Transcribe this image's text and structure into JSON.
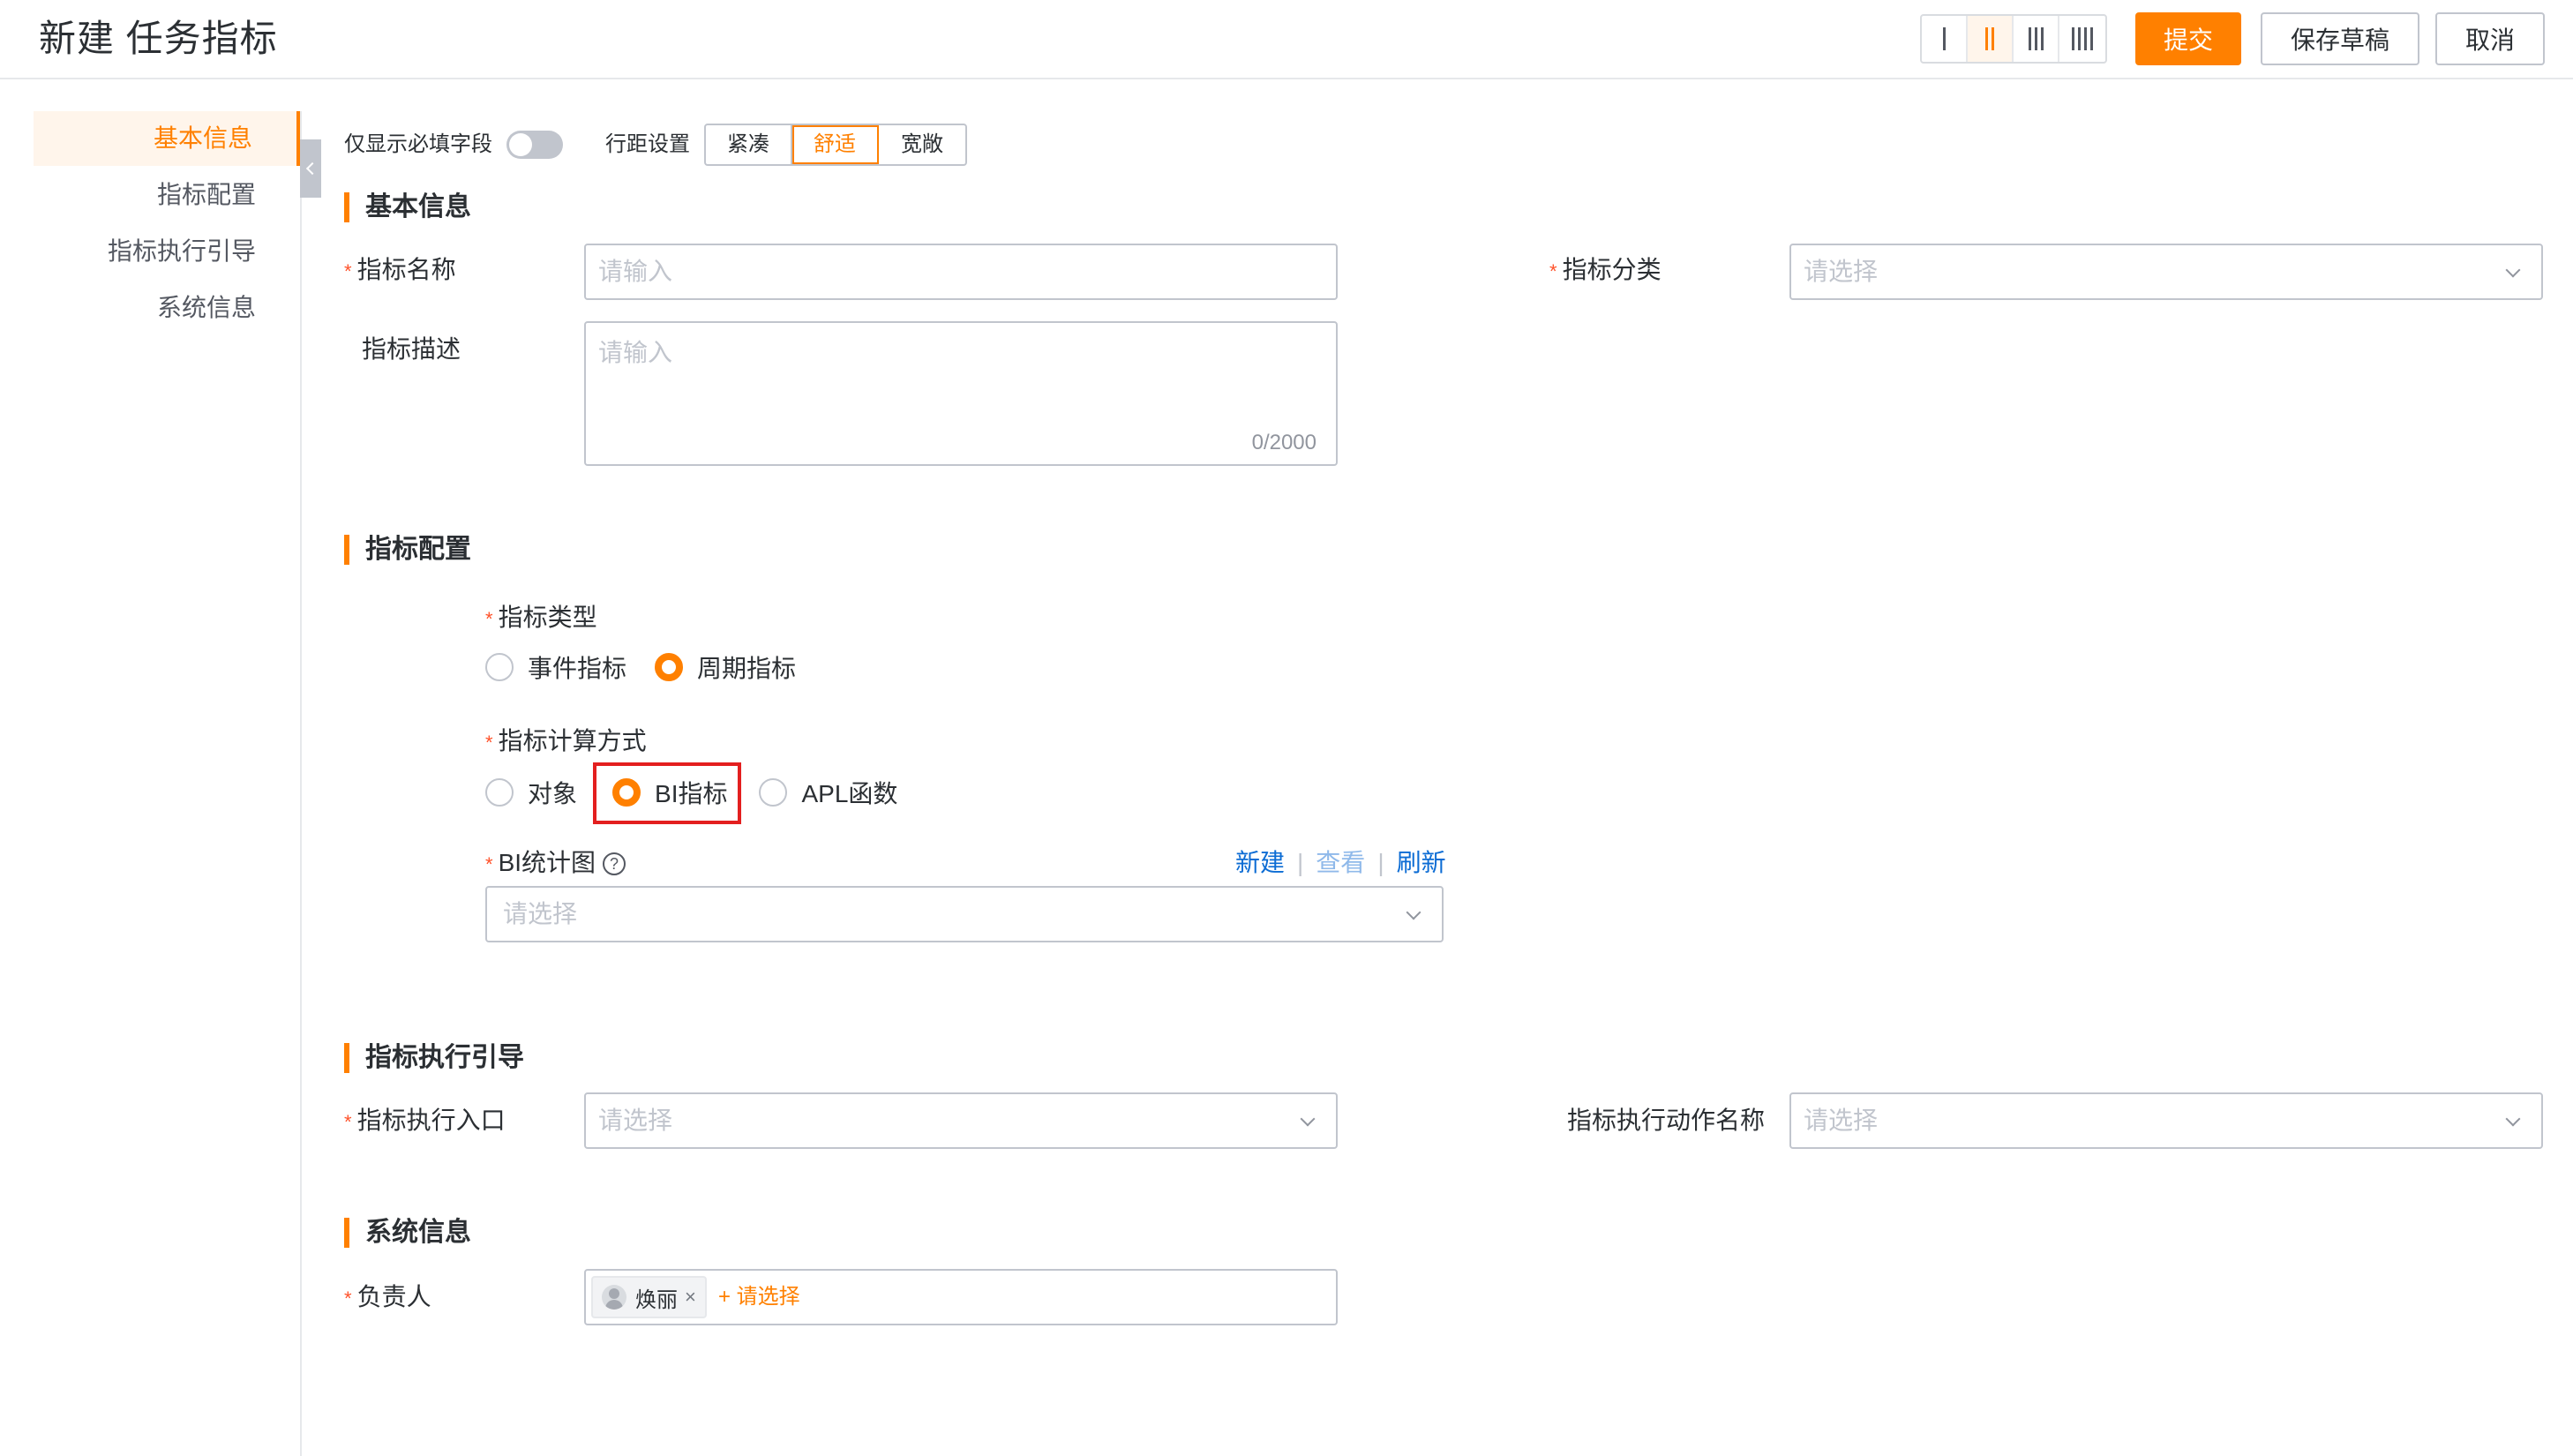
{
  "header": {
    "title": "新建 任务指标",
    "submit_label": "提交",
    "save_draft_label": "保存草稿",
    "cancel_label": "取消"
  },
  "nav": {
    "items": [
      {
        "label": "基本信息",
        "active": true
      },
      {
        "label": "指标配置",
        "active": false
      },
      {
        "label": "指标执行引导",
        "active": false
      },
      {
        "label": "系统信息",
        "active": false
      }
    ]
  },
  "toolbar": {
    "required_only_label": "仅显示必填字段",
    "row_spacing_label": "行距设置",
    "spacing_options": [
      "紧凑",
      "舒适",
      "宽敞"
    ],
    "spacing_selected": "舒适"
  },
  "sections": {
    "basic": {
      "title": "基本信息",
      "name_label": "指标名称",
      "name_placeholder": "请输入",
      "category_label": "指标分类",
      "category_placeholder": "请选择",
      "desc_label": "指标描述",
      "desc_placeholder": "请输入",
      "desc_count": "0/2000"
    },
    "config": {
      "title": "指标配置",
      "type_label": "指标类型",
      "type_options": [
        "事件指标",
        "周期指标"
      ],
      "type_selected": "周期指标",
      "calc_label": "指标计算方式",
      "calc_options": [
        "对象",
        "BI指标",
        "APL函数"
      ],
      "calc_selected": "BI指标",
      "bi_label": "BI统计图",
      "bi_help": "?",
      "bi_new": "新建",
      "bi_view": "查看",
      "bi_refresh": "刷新",
      "bi_placeholder": "请选择"
    },
    "guide": {
      "title": "指标执行引导",
      "entry_label": "指标执行入口",
      "entry_placeholder": "请选择",
      "action_label": "指标执行动作名称",
      "action_placeholder": "请选择"
    },
    "system": {
      "title": "系统信息",
      "owner_label": "负责人",
      "owner_name": "焕丽",
      "owner_remove": "×",
      "add_select": "+ 请选择"
    }
  },
  "colors": {
    "accent": "#ff8000",
    "link": "#0c6cd4",
    "required": "#ff522a",
    "highlight": "#e31f1f"
  }
}
